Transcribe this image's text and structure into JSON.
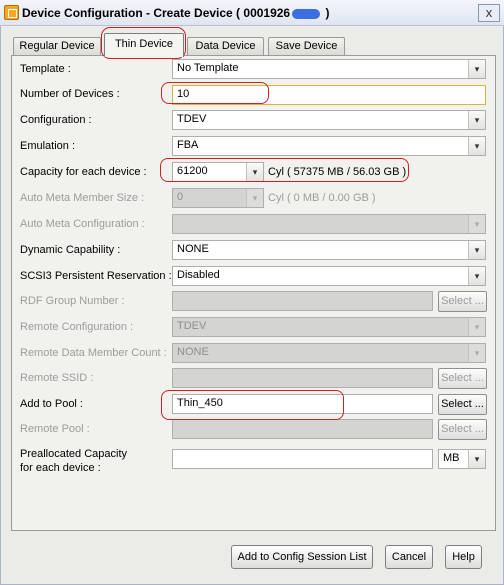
{
  "window": {
    "title_prefix": "Device Configuration - Create Device ( 0001926",
    "title_suffix": " )",
    "close_glyph": "x"
  },
  "tabs": [
    {
      "label": "Regular Device"
    },
    {
      "label": "Thin Device"
    },
    {
      "label": "Data Device"
    },
    {
      "label": "Save Device"
    }
  ],
  "form": {
    "template": {
      "label": "Template :",
      "value": "No Template"
    },
    "num_devices": {
      "label": "Number of Devices :",
      "value": "10"
    },
    "configuration": {
      "label": "Configuration :",
      "value": "TDEV"
    },
    "emulation": {
      "label": "Emulation :",
      "value": "FBA"
    },
    "capacity": {
      "label": "Capacity for each device :",
      "value": "61200",
      "unit": "Cyl ( 57375 MB / 56.03 GB )"
    },
    "auto_meta_size": {
      "label": "Auto Meta Member Size :",
      "value": "0",
      "unit": "Cyl ( 0 MB / 0.00 GB )"
    },
    "auto_meta_config": {
      "label": "Auto Meta Configuration :",
      "value": ""
    },
    "dynamic_capability": {
      "label": "Dynamic Capability :",
      "value": "NONE"
    },
    "scsi3": {
      "label": "SCSI3 Persistent Reservation :",
      "value": "Disabled"
    },
    "rdf_group": {
      "label": "RDF Group Number :",
      "value": "",
      "button": "Select ..."
    },
    "remote_config": {
      "label": "Remote Configuration :",
      "value": "TDEV"
    },
    "remote_data_member": {
      "label": "Remote Data Member Count :",
      "value": "NONE"
    },
    "remote_ssid": {
      "label": "Remote SSID :",
      "value": "",
      "button": "Select ..."
    },
    "add_to_pool": {
      "label": "Add to Pool :",
      "value": "Thin_450",
      "button": "Select ..."
    },
    "remote_pool": {
      "label": "Remote Pool :",
      "value": "",
      "button": "Select ..."
    },
    "prealloc": {
      "label_line1": "Preallocated Capacity",
      "label_line2": "for each device :",
      "value": "",
      "unit": "MB"
    }
  },
  "footer": {
    "add_button": "Add to Config Session List",
    "cancel_button": "Cancel",
    "help_button": "Help"
  },
  "dropdown_glyph": "▾",
  "colors": {
    "highlight": "#d31f1f",
    "title_mask": "#3b6fe0"
  }
}
